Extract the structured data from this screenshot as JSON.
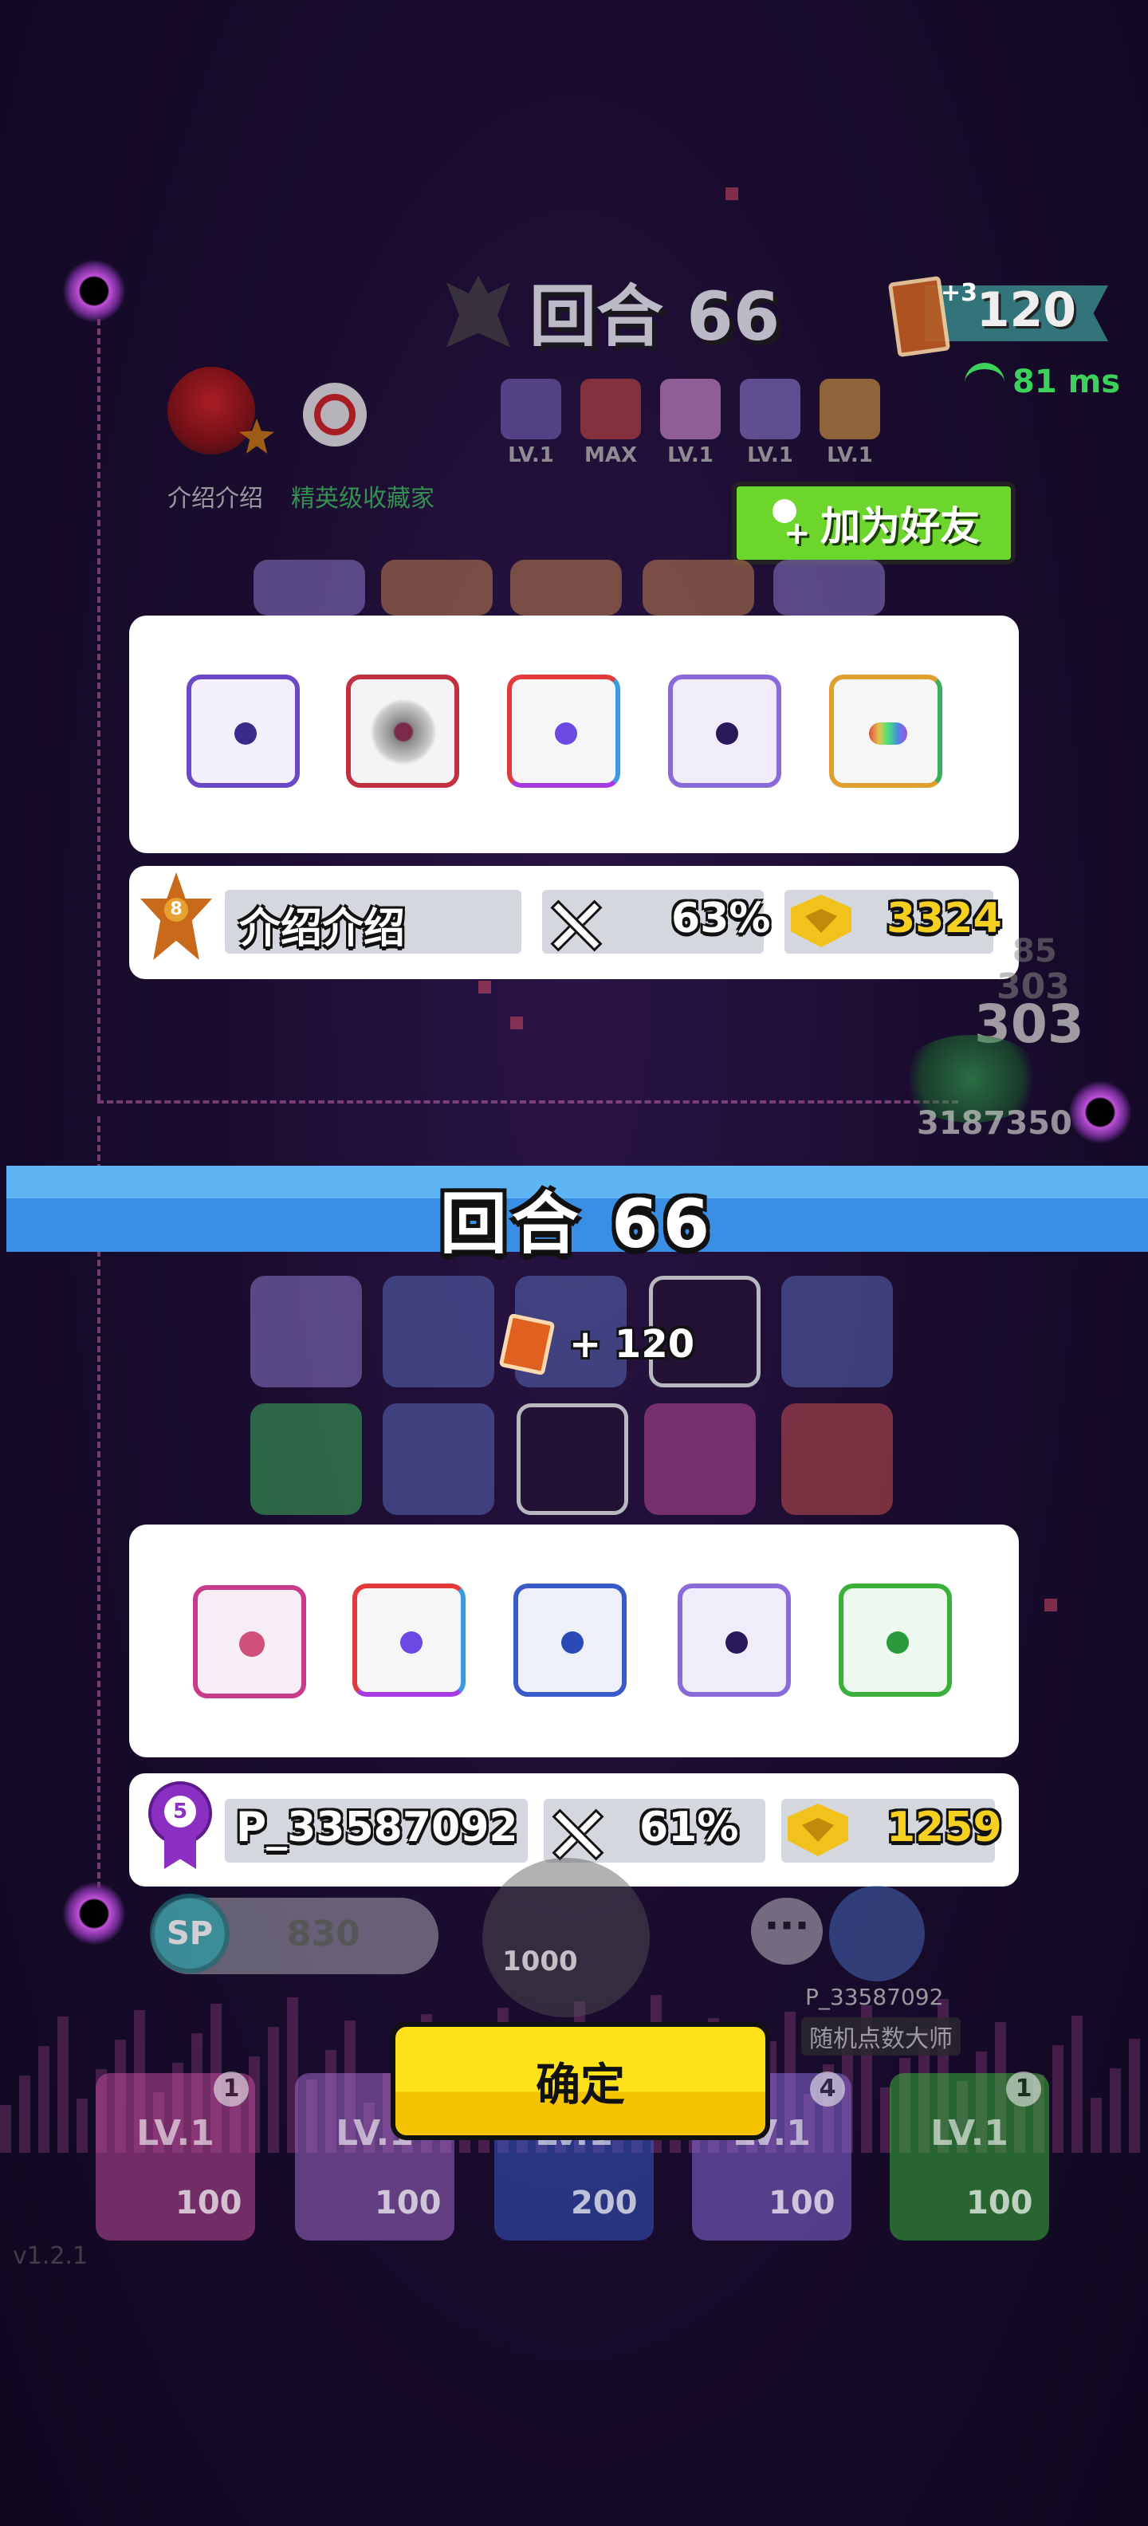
{
  "top_hud": {
    "round_label": "回合 66",
    "card_bonus": "+3",
    "card_count": "120",
    "ping": "81 ms"
  },
  "opponent": {
    "name": "介绍介绍",
    "title": "精英级收藏家",
    "badge_level": "8",
    "mini_dice_levels": [
      "LV.1",
      "MAX",
      "LV.1",
      "LV.1",
      "LV.1"
    ],
    "add_friend_label": "加为好友",
    "stats": {
      "rank": "8",
      "name": "介绍介绍",
      "win_rate": "63%",
      "trophies": "3324"
    }
  },
  "side_text": {
    "score_stack": [
      "85",
      "303",
      "303"
    ],
    "total": "3187350"
  },
  "banner": {
    "round_label": "回合  66"
  },
  "reward": {
    "text": "+ 120"
  },
  "player": {
    "stats": {
      "rank": "5",
      "name": "P_33587092",
      "win_rate": "61%",
      "trophies": "1259"
    },
    "sp_label": "SP",
    "sp_value": "830",
    "roll_cost": "1000",
    "name": "P_33587092",
    "title": "随机点数大师"
  },
  "deck": [
    {
      "lv": "LV.1",
      "cost": "100",
      "count": "1"
    },
    {
      "lv": "LV.1",
      "cost": "100",
      "count": ""
    },
    {
      "lv": "LV.1",
      "cost": "200",
      "count": ""
    },
    {
      "lv": "LV.1",
      "cost": "100",
      "count": "4"
    },
    {
      "lv": "LV.1",
      "cost": "100",
      "count": "1"
    }
  ],
  "confirm_label": "确定",
  "version": "v1.2.1",
  "colors": {
    "accent_green": "#6cd62c",
    "banner_blue": "#3a8fe4",
    "confirm_yellow": "#ffe21a",
    "gold": "#f5d020"
  }
}
